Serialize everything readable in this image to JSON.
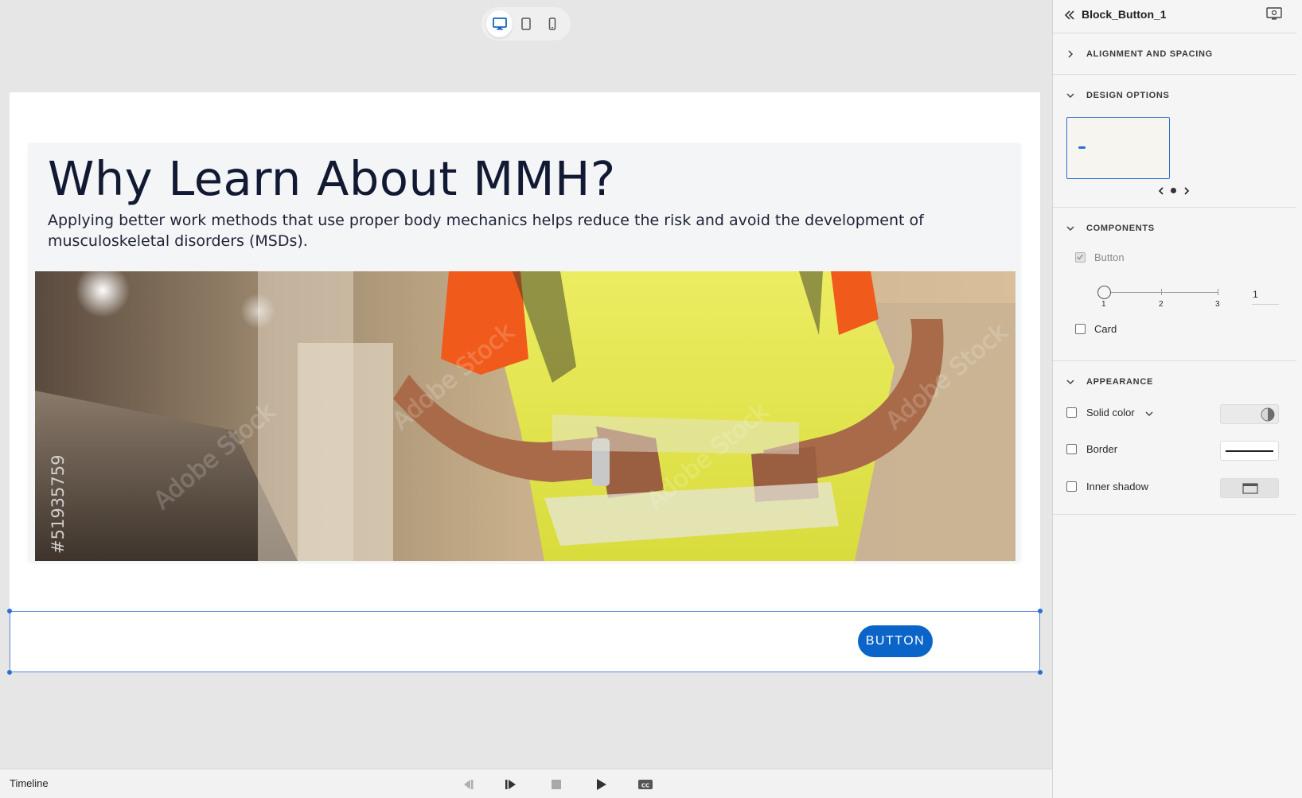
{
  "device_switch": {
    "active": "desktop",
    "icons": [
      "desktop-icon",
      "tablet-icon",
      "mobile-icon"
    ]
  },
  "slide": {
    "title": "Why Learn About MMH?",
    "description": "Applying better work methods that use proper body mechanics helps reduce the risk and avoid the development of musculoskeletal disorders (MSDs).",
    "image_watermark_id": "#51935759",
    "button_label": "BUTTON"
  },
  "timeline": {
    "label": "Timeline"
  },
  "panel": {
    "title": "Block_Button_1",
    "sections": {
      "alignment": "ALIGNMENT AND SPACING",
      "design": "DESIGN OPTIONS",
      "components": "COMPONENTS",
      "appearance": "APPEARANCE"
    },
    "components": {
      "button_label": "Button",
      "button_checked": true,
      "slider_ticks": [
        "1",
        "2",
        "3"
      ],
      "slider_value": "1",
      "card_label": "Card",
      "card_checked": false
    },
    "appearance": {
      "solid_color_label": "Solid color",
      "border_label": "Border",
      "inner_shadow_label": "Inner shadow"
    }
  },
  "colors": {
    "accent": "#0b65c9",
    "title": "#121a33",
    "selection": "#5b8bd4"
  }
}
